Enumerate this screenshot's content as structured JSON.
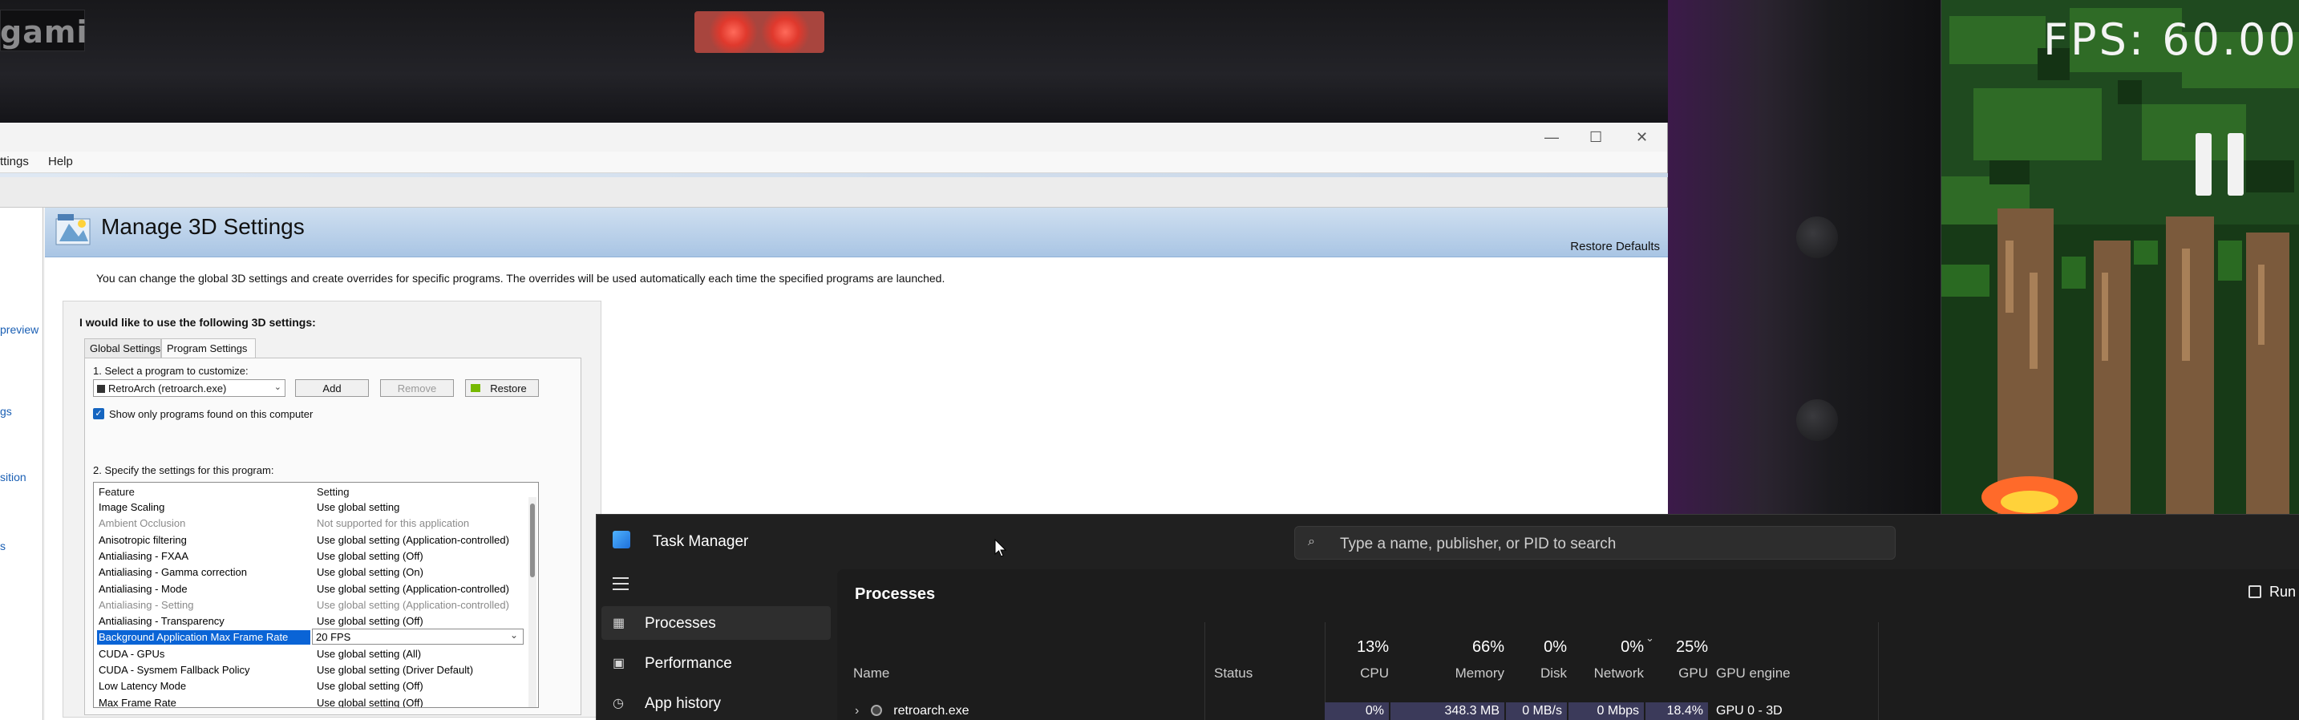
{
  "background": {
    "logo_text": "gami",
    "fps_label": "FPS:",
    "fps_value": "60.00",
    "colors": {
      "led": "#e0392d",
      "forest_dark": "#1f4a1f",
      "trunk": "#7b5a3c",
      "flame": "#ff6a2a"
    }
  },
  "nvidia": {
    "menu": {
      "settings": "ttings",
      "help": "Help"
    },
    "left_links": [
      "preview",
      "gs",
      "sition",
      "s"
    ],
    "page_title": "Manage 3D Settings",
    "restore_defaults": "Restore Defaults",
    "description": "You can change the global 3D settings and create overrides for specific programs. The overrides will be used automatically each time the specified programs are launched.",
    "group_title": "I would like to use the following 3D settings:",
    "tabs": [
      {
        "label": "Global Settings",
        "active": false
      },
      {
        "label": "Program Settings",
        "active": true
      }
    ],
    "step1_label": "1. Select a program to customize:",
    "program_combo": "RetroArch (retroarch.exe)",
    "add_button": "Add",
    "remove_button": "Remove",
    "restore_button": "Restore",
    "show_only_checkbox": "Show only programs found on this computer",
    "step2_label": "2. Specify the settings for this program:",
    "list_headers": {
      "feature": "Feature",
      "setting": "Setting"
    },
    "settings": [
      {
        "feature": "Image Scaling",
        "setting": "Use global setting",
        "dim": false
      },
      {
        "feature": "Ambient Occlusion",
        "setting": "Not supported for this application",
        "dim": true
      },
      {
        "feature": "Anisotropic filtering",
        "setting": "Use global setting (Application-controlled)",
        "dim": false
      },
      {
        "feature": "Antialiasing - FXAA",
        "setting": "Use global setting (Off)",
        "dim": false
      },
      {
        "feature": "Antialiasing - Gamma correction",
        "setting": "Use global setting (On)",
        "dim": false
      },
      {
        "feature": "Antialiasing - Mode",
        "setting": "Use global setting (Application-controlled)",
        "dim": false
      },
      {
        "feature": "Antialiasing - Setting",
        "setting": "Use global setting (Application-controlled)",
        "dim": true
      },
      {
        "feature": "Antialiasing - Transparency",
        "setting": "Use global setting (Off)",
        "dim": false
      },
      {
        "feature": "Background Application Max Frame Rate",
        "setting": "20 FPS",
        "dim": false,
        "selected": true
      },
      {
        "feature": "CUDA - GPUs",
        "setting": "Use global setting (All)",
        "dim": false
      },
      {
        "feature": "CUDA - Sysmem Fallback Policy",
        "setting": "Use global setting (Driver Default)",
        "dim": false
      },
      {
        "feature": "Low Latency Mode",
        "setting": "Use global setting (Off)",
        "dim": false
      },
      {
        "feature": "Max Frame Rate",
        "setting": "Use global setting (Off)",
        "dim": false
      }
    ]
  },
  "taskmanager": {
    "title": "Task Manager",
    "search_placeholder": "Type a name, publisher, or PID to search",
    "nav": [
      {
        "label": "Processes",
        "icon": "processes-icon",
        "active": true
      },
      {
        "label": "Performance",
        "icon": "performance-icon",
        "active": false
      },
      {
        "label": "App history",
        "icon": "app-history-icon",
        "active": false
      }
    ],
    "heading": "Processes",
    "run_new_task": "Run new ta",
    "columns": {
      "name": "Name",
      "status": "Status",
      "cpu": {
        "pct": "13%",
        "label": "CPU"
      },
      "memory": {
        "pct": "66%",
        "label": "Memory"
      },
      "disk": {
        "pct": "0%",
        "label": "Disk"
      },
      "network": {
        "pct": "0%",
        "label": "Network"
      },
      "gpu": {
        "pct": "25%",
        "label": "GPU"
      },
      "gpu_engine": "GPU engine"
    },
    "process": {
      "name": "retroarch.exe",
      "cpu": "0%",
      "memory": "348.3 MB",
      "disk": "0 MB/s",
      "network": "0 Mbps",
      "gpu": "18.4%",
      "gpu_engine": "GPU 0 - 3D"
    },
    "colors": {
      "highlight": "#3b3a5a",
      "background": "#202020"
    }
  }
}
